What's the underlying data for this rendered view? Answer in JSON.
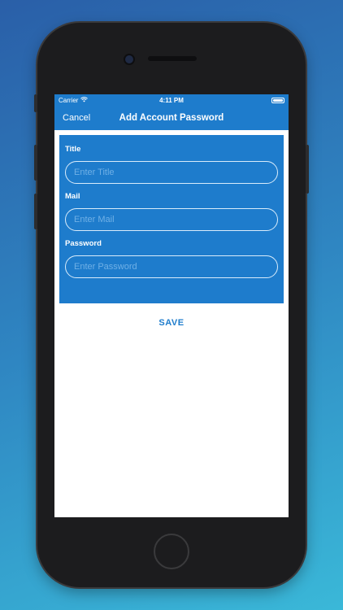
{
  "status_bar": {
    "carrier": "Carrier",
    "time": "4:11 PM"
  },
  "nav": {
    "cancel_label": "Cancel",
    "title": "Add Account Password"
  },
  "form": {
    "fields": [
      {
        "label": "Title",
        "placeholder": "Enter Title",
        "value": ""
      },
      {
        "label": "Mail",
        "placeholder": "Enter Mail",
        "value": ""
      },
      {
        "label": "Password",
        "placeholder": "Enter Password",
        "value": ""
      }
    ],
    "save_label": "SAVE"
  },
  "colors": {
    "accent": "#1e7ccc",
    "background_top": "#2a5fa8",
    "background_bottom": "#3ab8d8"
  }
}
